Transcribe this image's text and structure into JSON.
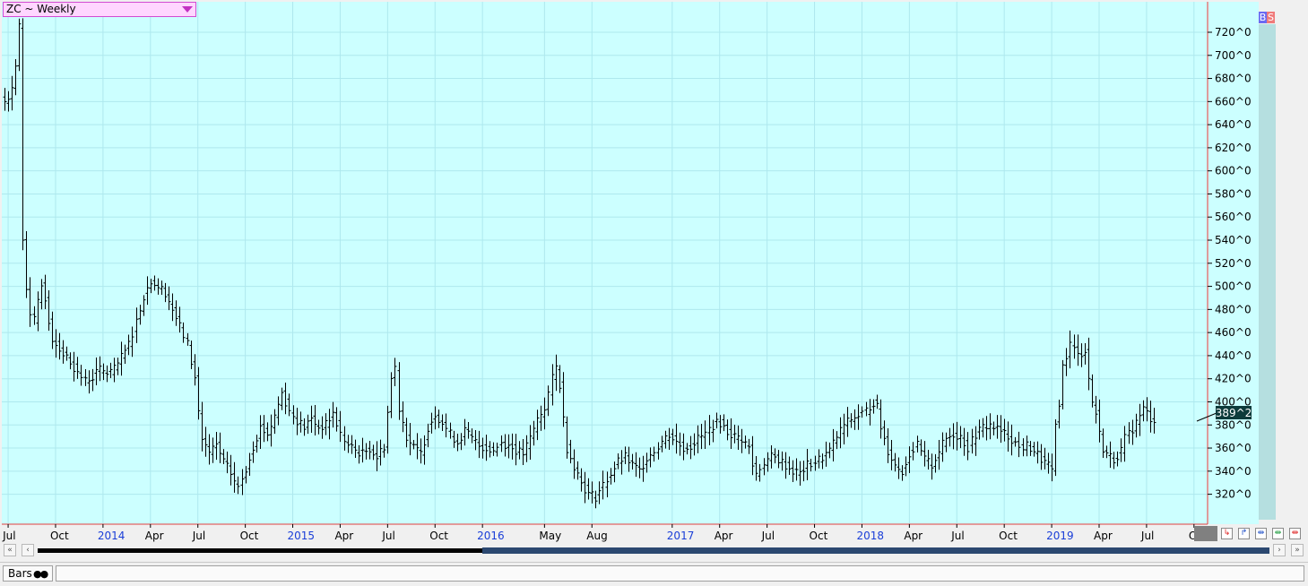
{
  "symbol": {
    "label": "ZC ~ Weekly"
  },
  "trade_buttons": {
    "buy": "B",
    "sell": "S"
  },
  "last_price_label": "389^2",
  "status": {
    "bars_label": "Bars"
  },
  "colors": {
    "plot_bg": "#ccffff",
    "grid": "#aee8ee",
    "bar": "#000000",
    "border": "#e04040",
    "year_label": "#1a3ed8",
    "month_label": "#000000",
    "price_flag": "#0d3b3b"
  },
  "chart_data": {
    "type": "bar",
    "subtype": "ohlc-weekly",
    "title": "",
    "xlabel": "",
    "ylabel": "",
    "grid": true,
    "ylim": [
      300,
      735
    ],
    "y_ticks": [
      320,
      340,
      360,
      380,
      400,
      420,
      440,
      460,
      480,
      500,
      520,
      540,
      560,
      580,
      600,
      620,
      640,
      660,
      680,
      700,
      720
    ],
    "y_tick_labels": [
      "320^0",
      "340^0",
      "360^0",
      "380^0",
      "400^0",
      "420^0",
      "440^0",
      "460^0",
      "480^0",
      "500^0",
      "520^0",
      "540^0",
      "560^0",
      "580^0",
      "600^0",
      "620^0",
      "640^0",
      "660^0",
      "680^0",
      "700^0",
      "720^0"
    ],
    "x_ticks": [
      {
        "label": "Jul",
        "year": false,
        "week": 1
      },
      {
        "label": "Oct",
        "year": false,
        "week": 14
      },
      {
        "label": "2014",
        "year": true,
        "week": 27
      },
      {
        "label": "Apr",
        "year": false,
        "week": 40
      },
      {
        "label": "Jul",
        "year": false,
        "week": 53
      },
      {
        "label": "Oct",
        "year": false,
        "week": 66
      },
      {
        "label": "2015",
        "year": true,
        "week": 79
      },
      {
        "label": "Apr",
        "year": false,
        "week": 92
      },
      {
        "label": "Jul",
        "year": false,
        "week": 105
      },
      {
        "label": "Oct",
        "year": false,
        "week": 118
      },
      {
        "label": "2016",
        "year": true,
        "week": 131
      },
      {
        "label": "May",
        "year": false,
        "week": 148
      },
      {
        "label": "Aug",
        "year": false,
        "week": 161
      },
      {
        "label": "2017",
        "year": true,
        "week": 183
      },
      {
        "label": "Apr",
        "year": false,
        "week": 196
      },
      {
        "label": "Jul",
        "year": false,
        "week": 209
      },
      {
        "label": "Oct",
        "year": false,
        "week": 222
      },
      {
        "label": "2018",
        "year": true,
        "week": 235
      },
      {
        "label": "Apr",
        "year": false,
        "week": 248
      },
      {
        "label": "Jul",
        "year": false,
        "week": 261
      },
      {
        "label": "Oct",
        "year": false,
        "week": 274
      },
      {
        "label": "2019",
        "year": true,
        "week": 287
      },
      {
        "label": "Apr",
        "year": false,
        "week": 300
      },
      {
        "label": "Jul",
        "year": false,
        "week": 313
      },
      {
        "label": "Oct",
        "year": false,
        "week": 326
      }
    ],
    "last_price": 389.25,
    "anchors": [
      [
        0,
        660
      ],
      [
        1,
        665
      ],
      [
        2,
        672
      ],
      [
        3,
        690
      ],
      [
        4,
        725
      ],
      [
        5,
        540
      ],
      [
        6,
        500
      ],
      [
        7,
        478
      ],
      [
        8,
        470
      ],
      [
        9,
        485
      ],
      [
        10,
        500
      ],
      [
        11,
        490
      ],
      [
        12,
        470
      ],
      [
        13,
        455
      ],
      [
        14,
        450
      ],
      [
        16,
        442
      ],
      [
        18,
        435
      ],
      [
        20,
        425
      ],
      [
        22,
        418
      ],
      [
        24,
        422
      ],
      [
        26,
        428
      ],
      [
        28,
        425
      ],
      [
        30,
        428
      ],
      [
        32,
        438
      ],
      [
        34,
        450
      ],
      [
        36,
        470
      ],
      [
        38,
        492
      ],
      [
        40,
        505
      ],
      [
        42,
        500
      ],
      [
        44,
        495
      ],
      [
        46,
        480
      ],
      [
        48,
        465
      ],
      [
        50,
        450
      ],
      [
        52,
        420
      ],
      [
        53,
        392
      ],
      [
        54,
        368
      ],
      [
        56,
        355
      ],
      [
        58,
        362
      ],
      [
        60,
        348
      ],
      [
        62,
        338
      ],
      [
        64,
        325
      ],
      [
        66,
        342
      ],
      [
        68,
        362
      ],
      [
        70,
        378
      ],
      [
        72,
        372
      ],
      [
        74,
        388
      ],
      [
        76,
        408
      ],
      [
        78,
        392
      ],
      [
        80,
        384
      ],
      [
        82,
        378
      ],
      [
        84,
        385
      ],
      [
        86,
        378
      ],
      [
        88,
        380
      ],
      [
        90,
        390
      ],
      [
        92,
        372
      ],
      [
        94,
        362
      ],
      [
        96,
        358
      ],
      [
        98,
        355
      ],
      [
        100,
        360
      ],
      [
        102,
        352
      ],
      [
        104,
        362
      ],
      [
        106,
        420
      ],
      [
        107,
        430
      ],
      [
        108,
        395
      ],
      [
        110,
        370
      ],
      [
        112,
        360
      ],
      [
        114,
        355
      ],
      [
        116,
        378
      ],
      [
        118,
        390
      ],
      [
        120,
        382
      ],
      [
        122,
        372
      ],
      [
        124,
        365
      ],
      [
        126,
        375
      ],
      [
        128,
        368
      ],
      [
        130,
        362
      ],
      [
        132,
        360
      ],
      [
        134,
        358
      ],
      [
        136,
        365
      ],
      [
        138,
        362
      ],
      [
        140,
        358
      ],
      [
        142,
        355
      ],
      [
        144,
        368
      ],
      [
        146,
        385
      ],
      [
        148,
        395
      ],
      [
        150,
        420
      ],
      [
        151,
        430
      ],
      [
        152,
        415
      ],
      [
        153,
        385
      ],
      [
        154,
        360
      ],
      [
        156,
        345
      ],
      [
        158,
        330
      ],
      [
        160,
        320
      ],
      [
        162,
        318
      ],
      [
        164,
        328
      ],
      [
        166,
        338
      ],
      [
        168,
        348
      ],
      [
        170,
        352
      ],
      [
        172,
        345
      ],
      [
        174,
        340
      ],
      [
        176,
        352
      ],
      [
        178,
        358
      ],
      [
        180,
        366
      ],
      [
        182,
        372
      ],
      [
        184,
        365
      ],
      [
        186,
        360
      ],
      [
        188,
        362
      ],
      [
        190,
        368
      ],
      [
        192,
        372
      ],
      [
        194,
        380
      ],
      [
        196,
        382
      ],
      [
        198,
        374
      ],
      [
        200,
        370
      ],
      [
        202,
        368
      ],
      [
        204,
        360
      ],
      [
        205,
        345
      ],
      [
        206,
        338
      ],
      [
        208,
        348
      ],
      [
        210,
        352
      ],
      [
        212,
        350
      ],
      [
        214,
        345
      ],
      [
        216,
        340
      ],
      [
        218,
        338
      ],
      [
        220,
        345
      ],
      [
        222,
        348
      ],
      [
        224,
        352
      ],
      [
        226,
        358
      ],
      [
        228,
        370
      ],
      [
        230,
        380
      ],
      [
        232,
        385
      ],
      [
        234,
        388
      ],
      [
        236,
        392
      ],
      [
        238,
        400
      ],
      [
        239,
        395
      ],
      [
        240,
        378
      ],
      [
        242,
        358
      ],
      [
        244,
        345
      ],
      [
        246,
        340
      ],
      [
        248,
        355
      ],
      [
        250,
        362
      ],
      [
        252,
        350
      ],
      [
        254,
        345
      ],
      [
        256,
        358
      ],
      [
        258,
        368
      ],
      [
        260,
        372
      ],
      [
        262,
        370
      ],
      [
        264,
        360
      ],
      [
        266,
        372
      ],
      [
        268,
        378
      ],
      [
        270,
        380
      ],
      [
        272,
        376
      ],
      [
        274,
        372
      ],
      [
        276,
        368
      ],
      [
        278,
        360
      ],
      [
        280,
        362
      ],
      [
        282,
        358
      ],
      [
        284,
        350
      ],
      [
        286,
        345
      ],
      [
        287,
        338
      ],
      [
        288,
        380
      ],
      [
        289,
        400
      ],
      [
        290,
        430
      ],
      [
        292,
        450
      ],
      [
        294,
        440
      ],
      [
        296,
        445
      ],
      [
        297,
        420
      ],
      [
        298,
        400
      ],
      [
        299,
        390
      ],
      [
        300,
        372
      ],
      [
        301,
        360
      ],
      [
        302,
        355
      ],
      [
        304,
        350
      ],
      [
        306,
        358
      ],
      [
        307,
        368
      ],
      [
        308,
        372
      ],
      [
        310,
        382
      ],
      [
        312,
        394
      ],
      [
        314,
        386
      ],
      [
        315,
        385
      ]
    ]
  }
}
